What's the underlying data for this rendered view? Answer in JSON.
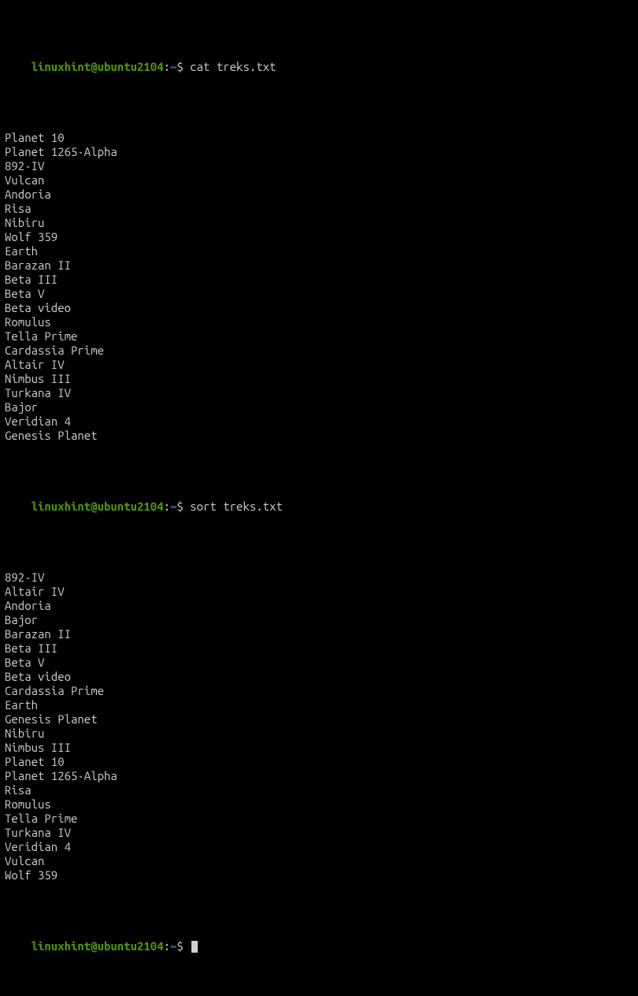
{
  "prompt": {
    "user_host": "linuxhint@ubuntu2104",
    "colon": ":",
    "path": "~",
    "dollar": "$"
  },
  "commands": {
    "cmd1": "cat treks.txt",
    "cmd2": "sort treks.txt"
  },
  "output1": [
    "Planet 10",
    "Planet 1265-Alpha",
    "892-IV",
    "Vulcan",
    "Andoria",
    "Risa",
    "Nibiru",
    "Wolf 359",
    "Earth",
    "Barazan II",
    "Beta III",
    "Beta V",
    "Beta video",
    "Romulus",
    "Tella Prime",
    "Cardassia Prime",
    "Altair IV",
    "Nimbus III",
    "Turkana IV",
    "Bajor",
    "Veridian 4",
    "Genesis Planet"
  ],
  "output2": [
    "892-IV",
    "Altair IV",
    "Andoria",
    "Bajor",
    "Barazan II",
    "Beta III",
    "Beta V",
    "Beta video",
    "Cardassia Prime",
    "Earth",
    "Genesis Planet",
    "Nibiru",
    "Nimbus III",
    "Planet 10",
    "Planet 1265-Alpha",
    "Risa",
    "Romulus",
    "Tella Prime",
    "Turkana IV",
    "Veridian 4",
    "Vulcan",
    "Wolf 359"
  ]
}
